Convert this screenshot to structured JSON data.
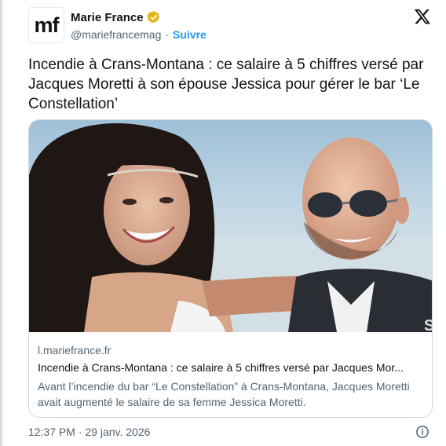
{
  "author": {
    "logo_text": "mf",
    "display_name": "Marie France",
    "handle": "@mariefrancemag",
    "separator": "·",
    "follow_label": "Suivre",
    "verified_color": "#e2b719"
  },
  "tweet": {
    "text": "Incendie à Crans-Montana : ce salaire à 5 chiffres versé par Jacques Moretti à son épouse Jessica pour gérer le bar ‘Le Constellation’",
    "timestamp": "12:37 PM · 29 janv. 2026"
  },
  "card": {
    "domain": "l.mariefrance.fr",
    "title": "Incendie à Crans-Montana : ce salaire à 5 chiffres versé par Jacques Mor...",
    "description": "Avant l’incendie du bar “Le Constellation” à Crans-Montana, Jacques Moretti avait augmenté le salaire de sa femme Jessica Moretti.",
    "watermark": "S"
  },
  "icons": {
    "platform": "x-logo-icon",
    "verified": "verified-badge-icon",
    "info": "info-icon"
  },
  "colors": {
    "link": "#1d9bf0",
    "secondary_text": "#536471",
    "border": "#cfd9de"
  }
}
